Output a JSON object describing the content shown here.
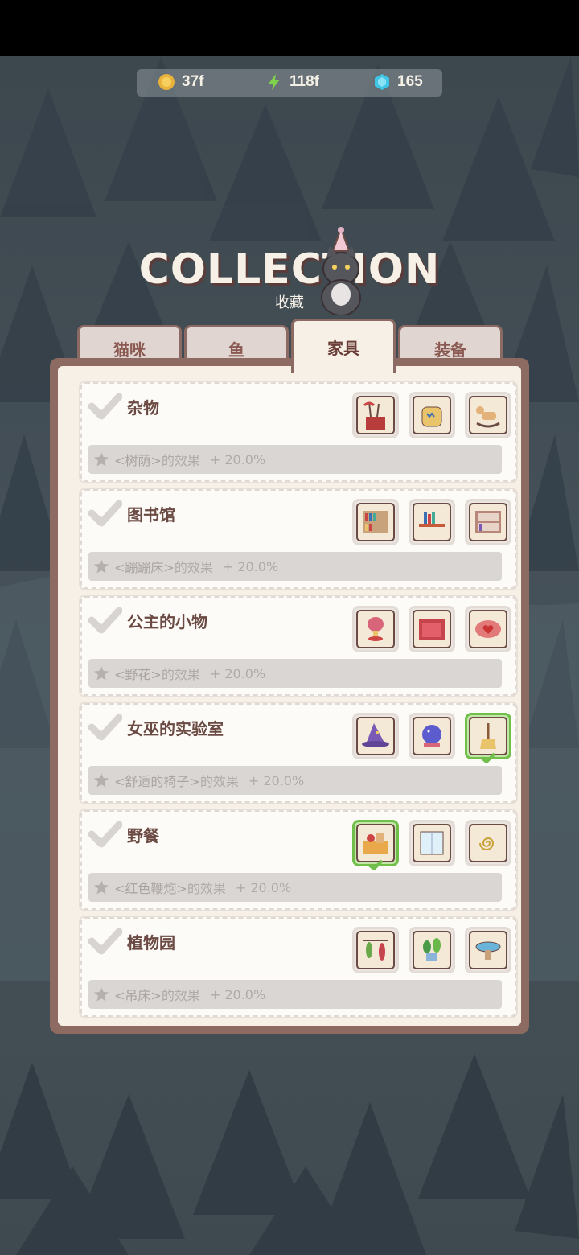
{
  "resources": {
    "coins": "37f",
    "energy": "118f",
    "gems": "165"
  },
  "header": {
    "title": "COLLECTION",
    "subtitle": "收藏"
  },
  "tabs": [
    {
      "label": "猫咪",
      "active": false
    },
    {
      "label": "鱼",
      "active": false
    },
    {
      "label": "家具",
      "active": true
    },
    {
      "label": "装备",
      "active": false
    }
  ],
  "collections": [
    {
      "name": "杂物",
      "effect_target": "<树荫>",
      "effect_suffix": "的效果",
      "bonus": "+ 20.0%",
      "items": [
        {
          "icon": "umbrella-stand-icon",
          "done": false
        },
        {
          "icon": "backpack-icon",
          "done": false
        },
        {
          "icon": "rocking-horse-icon",
          "done": false
        }
      ]
    },
    {
      "name": "图书馆",
      "effect_target": "<蹦蹦床>",
      "effect_suffix": "的效果",
      "bonus": "+ 20.0%",
      "items": [
        {
          "icon": "bookshelf-icon",
          "done": false
        },
        {
          "icon": "book-table-icon",
          "done": false
        },
        {
          "icon": "bookcase-icon",
          "done": false
        }
      ]
    },
    {
      "name": "公主的小物",
      "effect_target": "<野花>",
      "effect_suffix": "的效果",
      "bonus": "+ 20.0%",
      "items": [
        {
          "icon": "music-box-icon",
          "done": false
        },
        {
          "icon": "red-bed-icon",
          "done": false
        },
        {
          "icon": "heart-pillow-icon",
          "done": false
        }
      ]
    },
    {
      "name": "女巫的实验室",
      "effect_target": "<舒适的椅子>",
      "effect_suffix": "的效果",
      "bonus": "+ 20.0%",
      "items": [
        {
          "icon": "witch-hat-icon",
          "done": false
        },
        {
          "icon": "crystal-ball-icon",
          "done": false
        },
        {
          "icon": "broom-icon",
          "done": true
        }
      ]
    },
    {
      "name": "野餐",
      "effect_target": "<红色鞭炮>",
      "effect_suffix": "的效果",
      "bonus": "+ 20.0%",
      "items": [
        {
          "icon": "picnic-basket-icon",
          "done": true
        },
        {
          "icon": "window-icon",
          "done": false
        },
        {
          "icon": "mosquito-coil-icon",
          "done": false
        }
      ]
    },
    {
      "name": "植物园",
      "effect_target": "<吊床>",
      "effect_suffix": "的效果",
      "bonus": "+ 20.0%",
      "items": [
        {
          "icon": "hanging-plants-icon",
          "done": false
        },
        {
          "icon": "potted-plant-icon",
          "done": false
        },
        {
          "icon": "fountain-bowl-icon",
          "done": false
        }
      ]
    }
  ]
}
